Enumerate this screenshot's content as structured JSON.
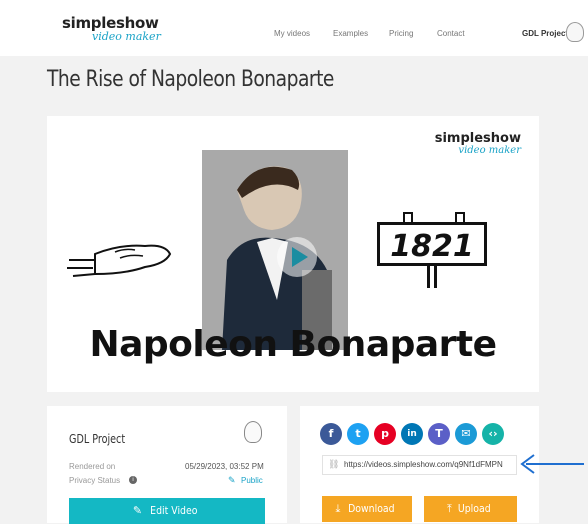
{
  "header": {
    "logo_brand": "simpleshow",
    "logo_sub": "video maker",
    "nav": [
      {
        "label": "My videos"
      },
      {
        "label": "Examples"
      },
      {
        "label": "Pricing"
      },
      {
        "label": "Contact"
      }
    ],
    "project": "GDL Project"
  },
  "page_title": "The Rise of Napoleon Bonaparte",
  "video": {
    "logo_brand": "simpleshow",
    "logo_sub": "video maker",
    "sign_text": "1821",
    "headline": "Napoleon Bonaparte"
  },
  "info": {
    "title": "GDL Project",
    "rendered_label": "Rendered on",
    "rendered_value": "05/29/2023, 03:52 PM",
    "privacy_label": "Privacy Status",
    "privacy_value": "Public",
    "edit_label": "Edit Video"
  },
  "share": {
    "url": "https://videos.simpleshow.com/q9Nf1dFMPN",
    "download_label": "Download",
    "upload_label": "Upload",
    "icons": [
      {
        "name": "facebook-icon",
        "glyph": "f",
        "color": "#3b5998"
      },
      {
        "name": "twitter-icon",
        "glyph": "t",
        "color": "#1da1f2"
      },
      {
        "name": "pinterest-icon",
        "glyph": "p",
        "color": "#e60023"
      },
      {
        "name": "linkedin-icon",
        "glyph": "in",
        "color": "#0077b5"
      },
      {
        "name": "teams-icon",
        "glyph": "T",
        "color": "#5b5fc7"
      },
      {
        "name": "email-icon",
        "glyph": "✉",
        "color": "#1b9ad6"
      },
      {
        "name": "embed-icon",
        "glyph": "‹›",
        "color": "#15b3a8"
      }
    ]
  },
  "colors": {
    "accent": "#1aa3c7",
    "teal_button": "#14b8c4",
    "orange_button": "#f5a623",
    "arrow": "#1f6fd0"
  }
}
